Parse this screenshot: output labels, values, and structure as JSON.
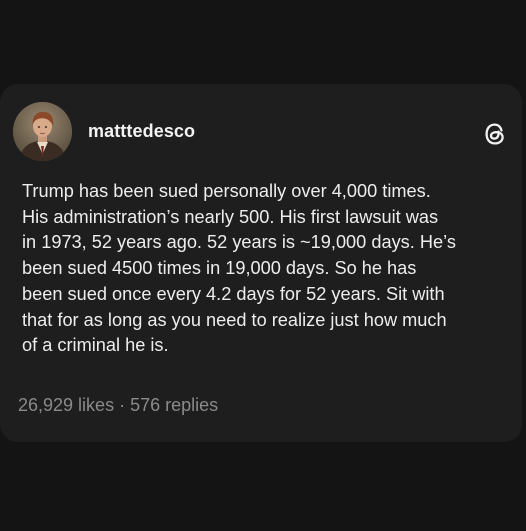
{
  "post": {
    "username": "matttedesco",
    "avatar_icon": "profile-photo-icon",
    "brand_icon": "threads-icon",
    "text": "Trump has been sued personally over 4,000 times.\nHis administration’s nearly 500. His first lawsuit was\nin 1973, 52 years ago. 52 years is ~19,000 days. He’s\nbeen sued 4500 times in 19,000 days. So he has\nbeen sued once every 4.2 days for 52 years. Sit with\nthat for as long as you need to realize just how much\nof a criminal he is.",
    "likes": "26,929 likes",
    "separator": "·",
    "replies": "576 replies"
  },
  "colors": {
    "background": "#141414",
    "card": "#1e1e1e",
    "text": "#ededed",
    "muted": "#8a8a8a"
  }
}
